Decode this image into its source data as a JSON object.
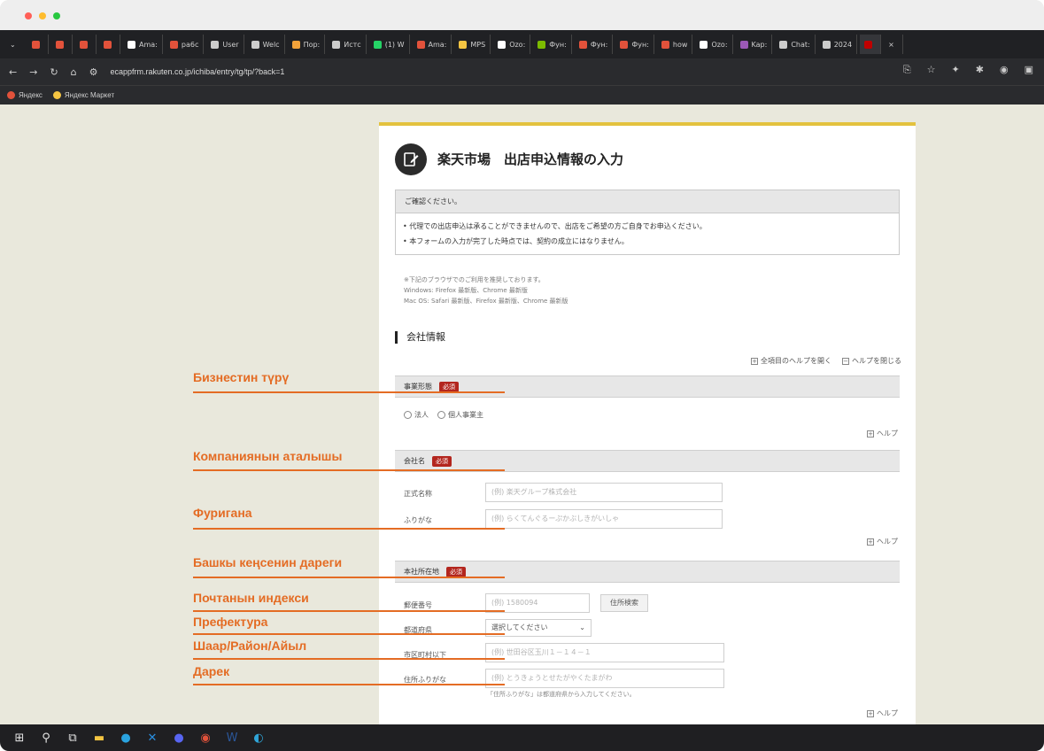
{
  "browser": {
    "tabs": [
      {
        "label": "",
        "color": "#e2523b"
      },
      {
        "label": "",
        "color": "#e2523b"
      },
      {
        "label": "",
        "color": "#e2523b"
      },
      {
        "label": "",
        "color": "#e2523b"
      },
      {
        "label": "Ama:",
        "color": "#ffffff"
      },
      {
        "label": "pa6c",
        "color": "#e2523b"
      },
      {
        "label": "User",
        "color": "#cccccc"
      },
      {
        "label": "Welc",
        "color": "#cccccc"
      },
      {
        "label": "Пор:",
        "color": "#f2a23a"
      },
      {
        "label": "Истс",
        "color": "#cccccc"
      },
      {
        "label": "(1) W",
        "color": "#25d366"
      },
      {
        "label": "Ama:",
        "color": "#e2523b"
      },
      {
        "label": "MPS",
        "color": "#f5c542"
      },
      {
        "label": "Ozo:",
        "color": "#ffffff"
      },
      {
        "label": "Фун:",
        "color": "#7cbb00"
      },
      {
        "label": "Фун:",
        "color": "#e2523b"
      },
      {
        "label": "Фун:",
        "color": "#e2523b"
      },
      {
        "label": "how",
        "color": "#e2523b"
      },
      {
        "label": "Ozo:",
        "color": "#ffffff"
      },
      {
        "label": "Kap:",
        "color": "#9b59b6"
      },
      {
        "label": "Chat:",
        "color": "#cccccc"
      },
      {
        "label": "2024",
        "color": "#cccccc"
      },
      {
        "label": "",
        "color": "#bf0000"
      }
    ],
    "url": "ecappfrm.rakuten.co.jp/ichiba/entry/tg/tp/?back=1",
    "bookmarks": [
      "Яндекс",
      "Яндекс Маркет"
    ]
  },
  "page": {
    "title": "楽天市場　出店申込情報の入力",
    "notice_head": "ご確認ください。",
    "notice_items": [
      "• 代理での出店申込は承ることができませんので、出店をご希望の方ご自身でお申込ください。",
      "• 本フォームの入力が完了した時点では、契約の成立にはなりません。"
    ],
    "browser_note": [
      "※下記のブラウザでのご利用を推奨しております。",
      "Windows: Firefox 最新版、Chrome 最新版",
      "Mac OS: Safari 最新版、Firefox 最新版、Chrome 最新版"
    ],
    "section_title": "会社情報",
    "help_open_all": "全項目のヘルプを開く",
    "help_close": "ヘルプを閉じる",
    "help": "ヘルプ",
    "required": "必須",
    "business_type": {
      "label": "事業形態",
      "options": [
        "法人",
        "個人事業主"
      ]
    },
    "company_name": {
      "label": "会社名",
      "official_label": "正式名称",
      "official_placeholder": "(例) 楽天グループ株式会社",
      "furigana_label": "ふりがな",
      "furigana_placeholder": "(例) らくてんぐるーぷかぶしきがいしゃ"
    },
    "address": {
      "label": "本社所在地",
      "postal_label": "郵便番号",
      "postal_placeholder": "(例) 1580094",
      "search_button": "住所検索",
      "prefecture_label": "都道府県",
      "prefecture_value": "選択してください",
      "city_label": "市区町村以下",
      "city_placeholder": "(例) 世田谷区玉川１－１４－１",
      "kana_label": "住所ふりがな",
      "kana_placeholder": "(例) とうきょうとせたがやくたまがわ",
      "kana_note": "「住所ふりがな」は都道府県から入力してください。"
    }
  },
  "annotations": [
    "Бизнестин түрү",
    "Компаниянын аталышы",
    "Фуригана",
    "Башкы кеңсенин дареги",
    "Почтанын индекси",
    "Префектура",
    "Шаар/Район/Айыл",
    "Дарек"
  ],
  "colors": {
    "accent": "#e46c24",
    "required": "#b3261e",
    "page_border": "#e3c23e"
  }
}
